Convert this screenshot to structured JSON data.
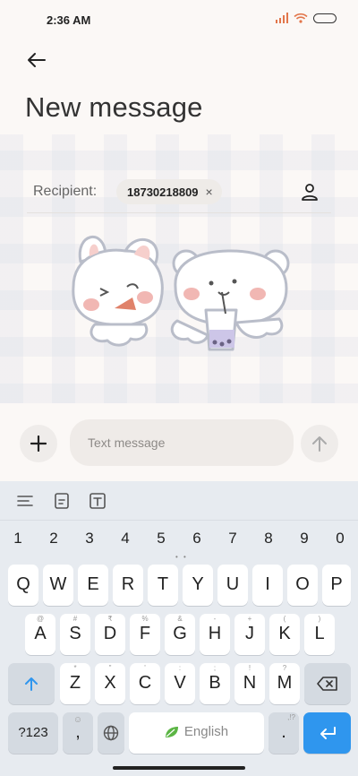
{
  "status_bar": {
    "time": "2:36 AM",
    "accent_color": "#e2764b"
  },
  "header": {
    "title": "New message",
    "back_icon": "arrow-left-icon"
  },
  "recipient": {
    "label": "Recipient:",
    "chip_number": "18730218809",
    "chip_close": "×",
    "contact_icon": "person-icon"
  },
  "compose": {
    "placeholder": "Text message",
    "attach_icon": "plus-icon",
    "send_icon": "arrow-up-icon"
  },
  "keyboard": {
    "toolbar_icons": [
      "menu-lines-icon",
      "clipboard-icon",
      "text-box-icon"
    ],
    "numbers": [
      "1",
      "2",
      "3",
      "4",
      "5",
      "6",
      "7",
      "8",
      "9",
      "0"
    ],
    "row1": [
      {
        "k": "Q",
        "h": ""
      },
      {
        "k": "W",
        "h": ""
      },
      {
        "k": "E",
        "h": ""
      },
      {
        "k": "R",
        "h": ""
      },
      {
        "k": "T",
        "h": ""
      },
      {
        "k": "Y",
        "h": ""
      },
      {
        "k": "U",
        "h": ""
      },
      {
        "k": "I",
        "h": ""
      },
      {
        "k": "O",
        "h": ""
      },
      {
        "k": "P",
        "h": ""
      }
    ],
    "row2": [
      {
        "k": "A",
        "h": "@"
      },
      {
        "k": "S",
        "h": "#"
      },
      {
        "k": "D",
        "h": "₹"
      },
      {
        "k": "F",
        "h": "%"
      },
      {
        "k": "G",
        "h": "&"
      },
      {
        "k": "H",
        "h": "-"
      },
      {
        "k": "J",
        "h": "+"
      },
      {
        "k": "K",
        "h": "("
      },
      {
        "k": "L",
        "h": ")"
      }
    ],
    "row3": [
      {
        "k": "Z",
        "h": "*"
      },
      {
        "k": "X",
        "h": "\""
      },
      {
        "k": "C",
        "h": "'"
      },
      {
        "k": "V",
        "h": ":"
      },
      {
        "k": "B",
        "h": ";"
      },
      {
        "k": "N",
        "h": "!"
      },
      {
        "k": "M",
        "h": "?"
      }
    ],
    "sym_label": "?123",
    "comma": ",",
    "space_label": "English",
    "period": ".",
    "period_hint": ",!?",
    "enter_color": "#2f96ee"
  }
}
